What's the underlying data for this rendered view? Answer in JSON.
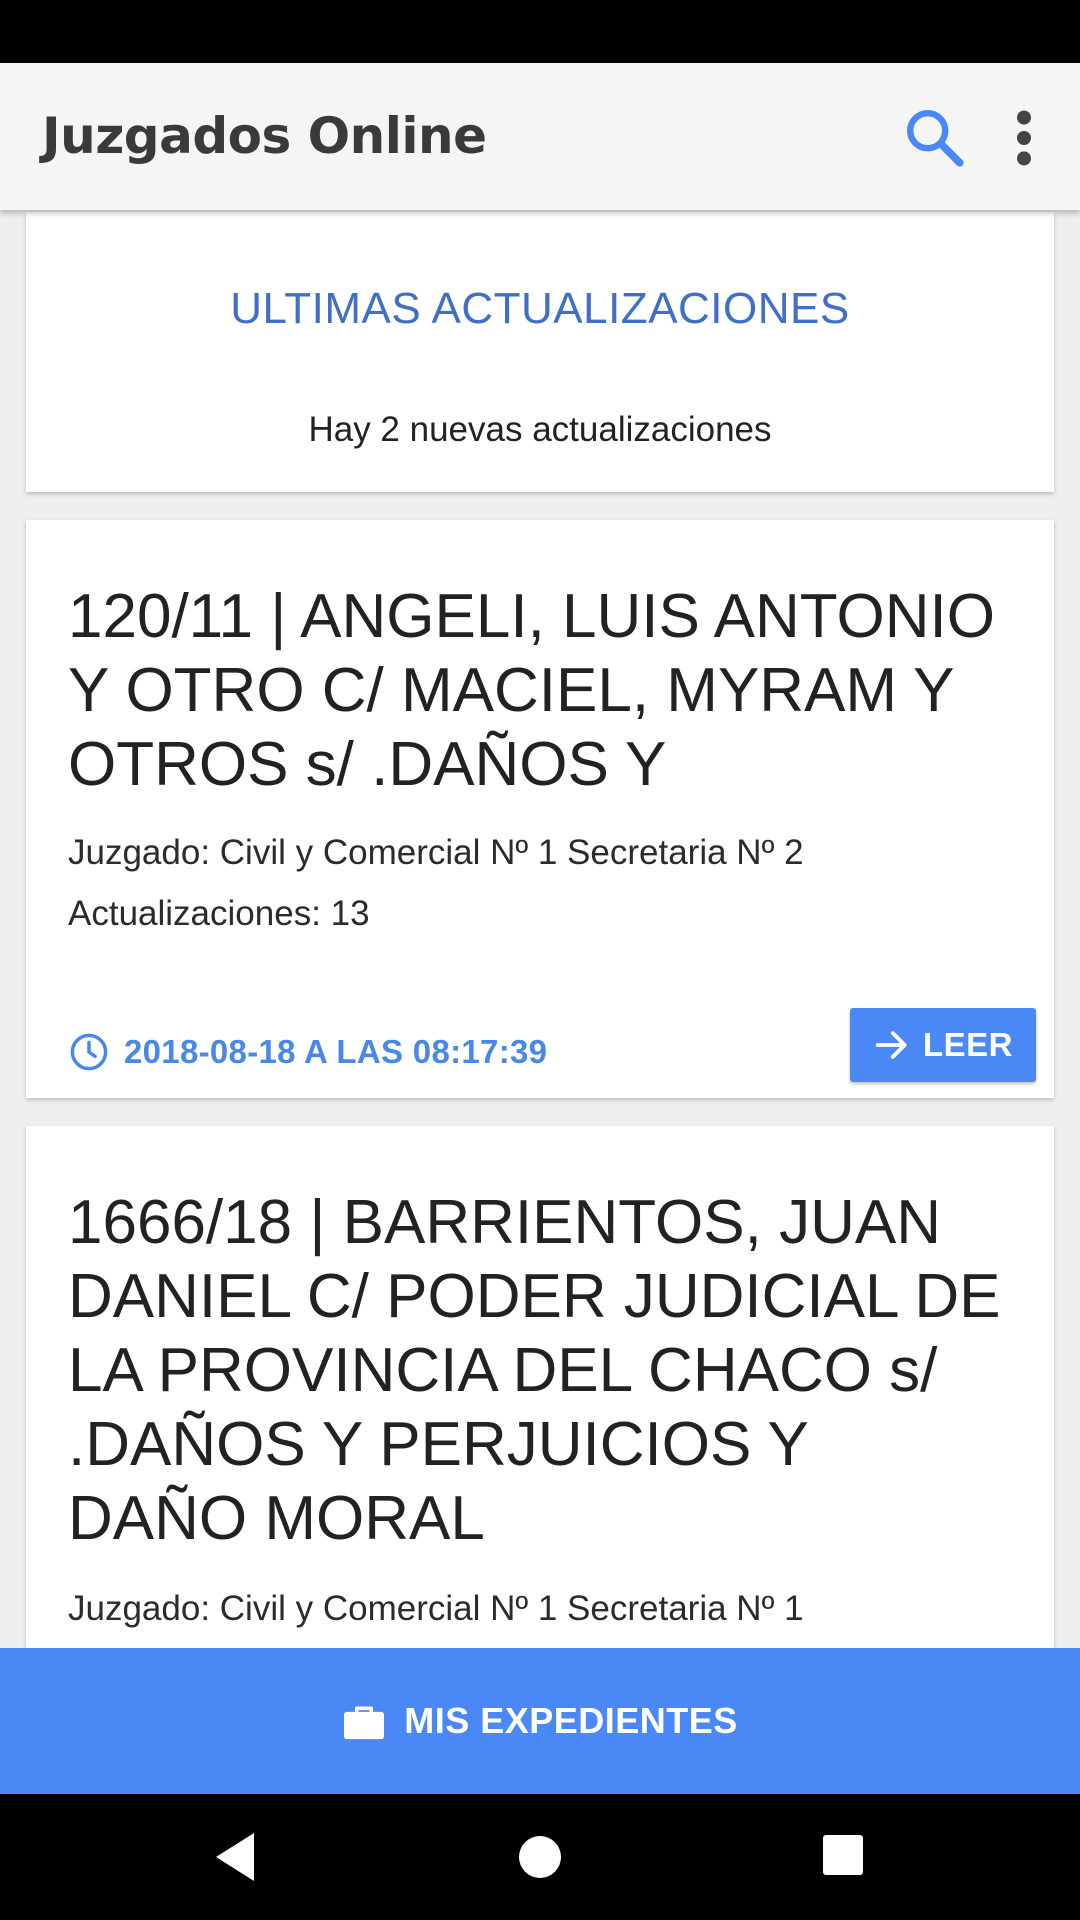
{
  "app": {
    "title": "Juzgados Online"
  },
  "icons": {
    "search": "search-icon",
    "more": "more-vert-icon",
    "clock": "clock-icon",
    "arrow": "arrow-right-icon",
    "briefcase": "briefcase-icon"
  },
  "colors": {
    "accent": "#4a88f5",
    "title_blue": "#3f6fc7"
  },
  "updates": {
    "title": "ULTIMAS ACTUALIZACIONES",
    "subtitle": "Hay 2 nuevas actualizaciones"
  },
  "cases": [
    {
      "title": "120/11 | ANGELI, LUIS ANTONIO Y OTRO C/ MACIEL, MYRAM Y OTROS s/ .DAÑOS Y",
      "court": "Juzgado: Civil y Comercial Nº 1 Secretaria Nº 2",
      "updates": "Actualizaciones: 13",
      "date": "2018-08-18 A LAS 08:17:39",
      "action_label": "LEER"
    },
    {
      "title": "1666/18 | BARRIENTOS, JUAN DANIEL C/ PODER JUDICIAL DE LA PROVINCIA DEL CHACO s/ .DAÑOS Y PERJUICIOS Y DAÑO MORAL",
      "court": "Juzgado: Civil y Comercial Nº 1 Secretaria Nº 1"
    }
  ],
  "bottom_action": {
    "label": "MIS EXPEDIENTES"
  }
}
